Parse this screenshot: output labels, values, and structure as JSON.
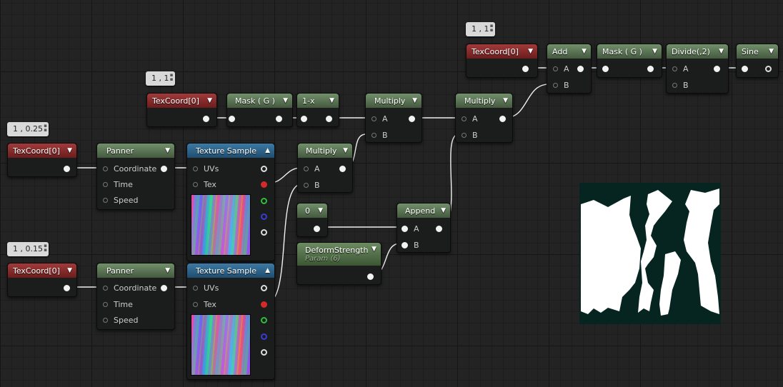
{
  "bubbles": {
    "b1": "1 , 1",
    "b2": "1 , 1",
    "b3": "1 , 0.25",
    "b4": "1 , 0.15"
  },
  "nodes": {
    "texcoord_top": "TexCoord[0]",
    "add": "Add",
    "mask_top": "Mask ( G )",
    "divide": "Divide(,2)",
    "sine": "Sine",
    "texcoord_mid": "TexCoord[0]",
    "mask_mid": "Mask ( G )",
    "one_minus_x": "1-x",
    "multiply_a": "Multiply",
    "multiply_b": "Multiply",
    "multiply_c": "Multiply",
    "texcoord_p1": "TexCoord[0]",
    "panner1": "Panner",
    "texsample1": "Texture Sample",
    "texcoord_p2": "TexCoord[0]",
    "panner2": "Panner",
    "texsample2": "Texture Sample",
    "const0": "0",
    "append": "Append",
    "deform": "DeformStrength",
    "deform_sub": "Param (6)"
  },
  "pins": {
    "a": "A",
    "b": "B",
    "coordinate": "Coordinate",
    "time": "Time",
    "speed": "Speed",
    "uvs": "UVs",
    "tex": "Tex"
  },
  "icons": {
    "dropdown": "▼",
    "collapse": "▲"
  },
  "colors": {
    "texcoord_header": "#8b2b2b",
    "math_header": "#5a7552",
    "texture_header": "#2d6890",
    "wire": "#ffffff"
  }
}
